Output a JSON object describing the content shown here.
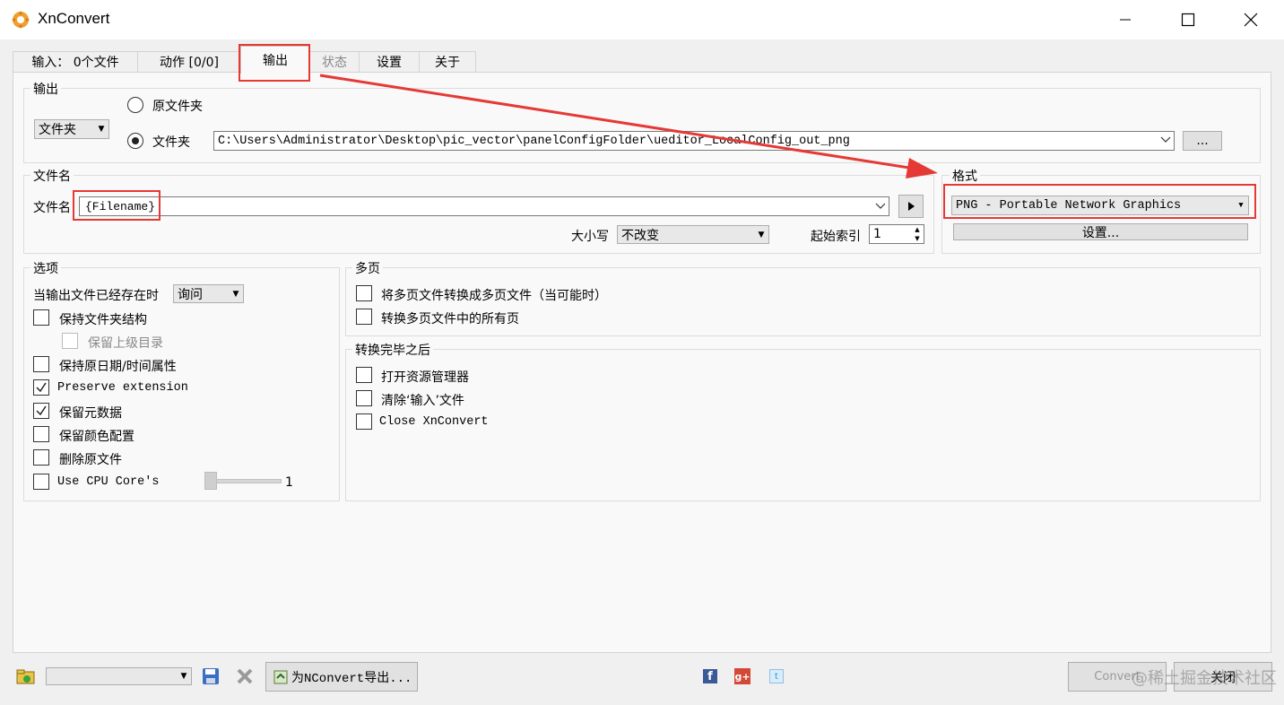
{
  "window": {
    "title": "XnConvert"
  },
  "tabs": [
    {
      "label": "输入： 0个文件"
    },
    {
      "label": "动作 [0/0]"
    },
    {
      "label": "输出"
    },
    {
      "label": "状态"
    },
    {
      "label": "设置"
    },
    {
      "label": "关于"
    }
  ],
  "output_group": {
    "legend": "输出",
    "folder_combo": "文件夹",
    "radio_original": "原文件夹",
    "radio_folder": "文件夹",
    "path_value": "C:\\Users\\Administrator\\Desktop\\pic_vector\\panelConfigFolder\\ueditor_LocalConfig_out_png",
    "browse_label": "..."
  },
  "filename_group": {
    "legend": "文件名",
    "label": "文件名",
    "value": "{Filename}",
    "case_label": "大小写",
    "case_value": "不改变",
    "start_index_label": "起始索引",
    "start_index_value": "1"
  },
  "format_group": {
    "legend": "格式",
    "value": "PNG - Portable Network Graphics",
    "settings_label": "设置..."
  },
  "options_group": {
    "legend": "选项",
    "exists_label": "当输出文件已经存在时",
    "exists_value": "询问",
    "items": [
      {
        "label": "保持文件夹结构",
        "checked": false
      },
      {
        "label": "保留上级目录",
        "checked": false,
        "disabled": true
      },
      {
        "label": "保持原日期/时间属性",
        "checked": false
      },
      {
        "label": "Preserve extension",
        "checked": true
      },
      {
        "label": "保留元数据",
        "checked": true
      },
      {
        "label": "保留颜色配置",
        "checked": false
      },
      {
        "label": "删除原文件",
        "checked": false
      },
      {
        "label": "Use CPU Core's",
        "checked": false
      }
    ],
    "cpu_value": "1"
  },
  "multipage_group": {
    "legend": "多页",
    "items": [
      {
        "label": "将多页文件转换成多页文件（当可能时）",
        "checked": false
      },
      {
        "label": "转换多页文件中的所有页",
        "checked": false
      }
    ]
  },
  "after_group": {
    "legend": "转换完毕之后",
    "items": [
      {
        "label": "打开资源管理器",
        "checked": false
      },
      {
        "label": "清除‘输入’文件",
        "checked": false
      },
      {
        "label": "Close XnConvert",
        "checked": false
      }
    ]
  },
  "bottom": {
    "export_label": "为NConvert导出...",
    "convert_label": "Convert",
    "close_label": "关闭",
    "watermark": "@稀土掘金技术社区"
  },
  "colors": {
    "accent_red": "#e53935",
    "panel_bg": "#f9f9f9",
    "window_bg": "#f0f0f0"
  }
}
